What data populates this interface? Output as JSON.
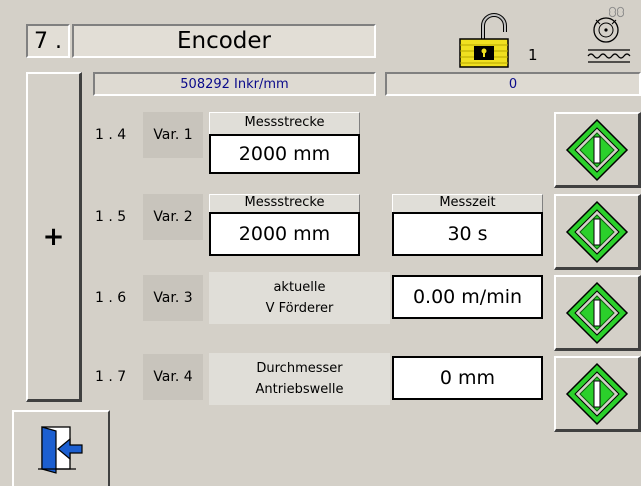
{
  "header": {
    "step_number": "7 .",
    "title": "Encoder",
    "lock_count": "1"
  },
  "info_bar": {
    "resolution": "508292 Inkr/mm",
    "counter": "0"
  },
  "plus_label": "+",
  "rows": [
    {
      "index": "1 . 4",
      "variant": "Var. 1",
      "label1": "Messstrecke",
      "value1": "2000 mm"
    },
    {
      "index": "1 . 5",
      "variant": "Var. 2",
      "label1": "Messstrecke",
      "value1": "2000 mm",
      "label2": "Messzeit",
      "value2": "30 s"
    },
    {
      "index": "1 . 6",
      "variant": "Var. 3",
      "label_line1": "aktuelle",
      "label_line2": "V  Förderer",
      "value": "0.00 m/min"
    },
    {
      "index": "1 . 7",
      "variant": "Var. 4",
      "label_line1": "Durchmesser",
      "label_line2": "Antriebswelle",
      "value": "0 mm"
    }
  ],
  "colors": {
    "panel": "#d4d0c8",
    "accent_green": "#2bd02b",
    "info_text": "#0a0a8a",
    "exit_blue": "#1c5fd0"
  },
  "icons": {
    "lock": "padlock-icon",
    "encoder": "encoder-icon",
    "confirm": "green-diamond-icon",
    "exit": "exit-door-icon"
  }
}
